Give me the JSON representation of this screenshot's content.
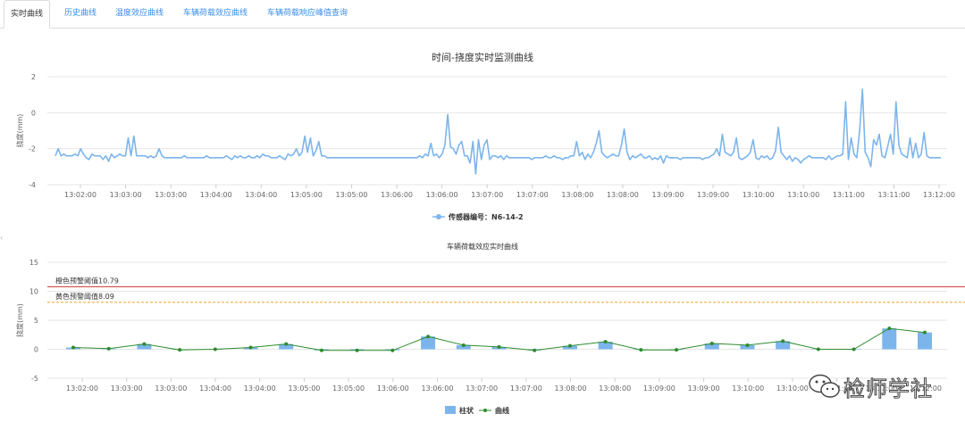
{
  "tabs": [
    {
      "label": "实时曲线",
      "active": true
    },
    {
      "label": "历史曲线",
      "active": false
    },
    {
      "label": "温度效应曲线",
      "active": false
    },
    {
      "label": "车辆荷载效应曲线",
      "active": false
    },
    {
      "label": "车辆荷载响应峰值查询",
      "active": false
    }
  ],
  "watermark": {
    "text": "检师学社",
    "icon": "wechat-icon"
  },
  "side_handle_icon": "chevron-left-icon",
  "chart_data": [
    {
      "type": "line",
      "title": "时间-挠度实时监测曲线",
      "ylabel": "挠度(mm)",
      "ylim": [
        -4,
        2
      ],
      "yticks": [
        2,
        0,
        -2,
        -4
      ],
      "color": "#7cb5ec",
      "xticks": [
        "13:02:00",
        "13:03:00",
        "13:03:00",
        "13:04:00",
        "13:04:00",
        "13:05:00",
        "13:05:00",
        "13:06:00",
        "13:06:00",
        "13:07:00",
        "13:07:00",
        "13:08:00",
        "13:08:00",
        "13:09:00",
        "13:09:00",
        "13:10:00",
        "13:10:00",
        "13:11:00",
        "13:11:00",
        "13:12:00"
      ],
      "grid": true,
      "legend_position": "bottom-center",
      "series": [
        {
          "name": "传感器编号：N6-14-2",
          "values": [
            -2.4,
            -2.0,
            -2.4,
            -2.3,
            -2.4,
            -2.4,
            -2.4,
            -2.3,
            -2.4,
            -2.0,
            -2.3,
            -2.5,
            -2.6,
            -2.3,
            -2.4,
            -2.4,
            -2.4,
            -2.6,
            -2.4,
            -2.7,
            -2.3,
            -2.5,
            -2.4,
            -2.3,
            -2.4,
            -2.4,
            -1.4,
            -2.4,
            -1.3,
            -2.4,
            -2.4,
            -2.4,
            -2.4,
            -2.5,
            -2.4,
            -2.5,
            -2.4,
            -2.0,
            -2.4,
            -2.5,
            -2.5,
            -2.5,
            -2.5,
            -2.5,
            -2.5,
            -2.5,
            -2.4,
            -2.5,
            -2.5,
            -2.5,
            -2.5,
            -2.5,
            -2.5,
            -2.5,
            -2.4,
            -2.5,
            -2.5,
            -2.5,
            -2.5,
            -2.5,
            -2.5,
            -2.4,
            -2.5,
            -2.6,
            -2.4,
            -2.5,
            -2.4,
            -2.5,
            -2.5,
            -2.4,
            -2.5,
            -2.5,
            -2.4,
            -2.5,
            -2.3,
            -2.4,
            -2.4,
            -2.5,
            -2.5,
            -2.5,
            -2.4,
            -2.5,
            -2.6,
            -2.3,
            -2.4,
            -2.3,
            -2.0,
            -2.4,
            -2.2,
            -1.3,
            -2.2,
            -1.4,
            -2.4,
            -2.1,
            -1.6,
            -2.4,
            -2.4,
            -2.5,
            -2.5,
            -2.5,
            -2.5,
            -2.5,
            -2.5,
            -2.5,
            -2.5,
            -2.5,
            -2.5,
            -2.5,
            -2.5,
            -2.5,
            -2.5,
            -2.5,
            -2.5,
            -2.5,
            -2.5,
            -2.5,
            -2.5,
            -2.5,
            -2.5,
            -2.5,
            -2.5,
            -2.5,
            -2.5,
            -2.5,
            -2.5,
            -2.5,
            -2.5,
            -2.5,
            -2.5,
            -2.5,
            -2.4,
            -2.5,
            -2.3,
            -2.4,
            -1.7,
            -2.4,
            -2.3,
            -2.5,
            -2.3,
            -1.8,
            -0.1,
            -1.9,
            -2.0,
            -2.3,
            -1.8,
            -1.6,
            -2.4,
            -2.4,
            -2.8,
            -1.6,
            -3.4,
            -1.5,
            -2.6,
            -1.8,
            -1.5,
            -2.6,
            -2.4,
            -2.4,
            -2.5,
            -2.4,
            -2.6,
            -2.4,
            -2.5,
            -2.5,
            -2.5,
            -2.5,
            -2.5,
            -2.5,
            -2.5,
            -2.5,
            -2.6,
            -2.5,
            -2.5,
            -2.5,
            -2.5,
            -2.4,
            -2.5,
            -2.5,
            -2.4,
            -2.5,
            -2.5,
            -2.6,
            -2.5,
            -2.5,
            -2.4,
            -2.4,
            -1.6,
            -2.4,
            -2.2,
            -2.6,
            -2.3,
            -2.5,
            -2.2,
            -1.7,
            -1.0,
            -2.2,
            -2.4,
            -2.5,
            -2.4,
            -2.3,
            -2.4,
            -2.4,
            -1.8,
            -0.9,
            -2.2,
            -2.6,
            -2.4,
            -2.5,
            -2.4,
            -2.3,
            -2.5,
            -2.5,
            -2.4,
            -2.6,
            -2.5,
            -2.6,
            -2.4,
            -2.8,
            -2.4,
            -2.5,
            -2.5,
            -2.5,
            -2.5,
            -2.6,
            -2.5,
            -2.5,
            -2.5,
            -2.5,
            -2.5,
            -2.5,
            -2.5,
            -2.6,
            -2.5,
            -2.5,
            -2.4,
            -2.3,
            -2.0,
            -2.4,
            -1.2,
            -2.2,
            -2.3,
            -2.4,
            -2.2,
            -1.4,
            -2.5,
            -2.6,
            -2.5,
            -2.4,
            -2.2,
            -1.5,
            -2.5,
            -2.6,
            -2.4,
            -2.5,
            -2.4,
            -2.6,
            -2.5,
            -2.1,
            -0.8,
            -2.2,
            -2.4,
            -2.6,
            -2.4,
            -2.7,
            -2.5,
            -2.6,
            -2.8,
            -2.6,
            -2.5,
            -2.4,
            -2.5,
            -2.5,
            -2.5,
            -2.5,
            -2.5,
            -2.6,
            -2.4,
            -2.6,
            -2.5,
            -2.4,
            -2.4,
            -2.3,
            0.6,
            -2.6,
            -1.4,
            -2.3,
            -2.5,
            -1.0,
            1.3,
            -2.2,
            -2.5,
            -3.0,
            -1.5,
            -1.8,
            -1.2,
            -2.4,
            -2.5,
            -1.9,
            -1.2,
            -2.3,
            0.6,
            -1.8,
            -2.3,
            -2.4,
            -2.5,
            -1.4,
            -2.5,
            -1.7,
            -2.5,
            -2.3,
            -1.1,
            -2.4,
            -2.5,
            -2.5,
            -2.5,
            -2.5,
            -2.5
          ]
        }
      ]
    },
    {
      "type": "bar",
      "title": "车辆荷载效应实时曲线",
      "ylabel": "挠度(mm)",
      "ylim": [
        -5,
        15
      ],
      "yticks": [
        15,
        10,
        5,
        0,
        -5
      ],
      "xticks": [
        "13:02:00",
        "13:03:00",
        "13:03:00",
        "13:04:00",
        "13:04:00",
        "13:05:00",
        "13:05:00",
        "13:06:00",
        "13:06:00",
        "13:07:00",
        "13:07:00",
        "13:08:00",
        "13:08:00",
        "13:09:00",
        "13:09:00",
        "13:10:00",
        "13:10:00",
        "13:11:00",
        "13:11:00",
        "13:12:00"
      ],
      "grid": true,
      "legend_position": "bottom-center",
      "thresholds": [
        {
          "label": "橙色预警阈值10.79",
          "value": 10.79,
          "color": "#cc3333",
          "style": "solid"
        },
        {
          "label": "黄色预警阈值8.09",
          "value": 8.09,
          "color": "#f0a030",
          "style": "dashed"
        }
      ],
      "series": [
        {
          "name": "柱状",
          "type": "bar",
          "color": "#7cb5ec",
          "values": [
            0.3,
            0.1,
            0.9,
            -0.1,
            0,
            0.3,
            0.9,
            -0.2,
            -0.2,
            -0.2,
            2.2,
            0.7,
            0.4,
            -0.2,
            0.6,
            1.3,
            -0.1,
            -0.1,
            1.0,
            0.7,
            1.4,
            0,
            0,
            3.6,
            2.9
          ]
        },
        {
          "name": "曲线",
          "type": "line",
          "color": "#2e8b2e",
          "values": [
            0.3,
            0.1,
            0.9,
            -0.1,
            0,
            0.3,
            0.9,
            -0.2,
            -0.2,
            -0.2,
            2.2,
            0.7,
            0.4,
            -0.2,
            0.6,
            1.3,
            -0.1,
            -0.1,
            1.0,
            0.7,
            1.4,
            0,
            0,
            3.6,
            2.9
          ]
        }
      ]
    }
  ]
}
